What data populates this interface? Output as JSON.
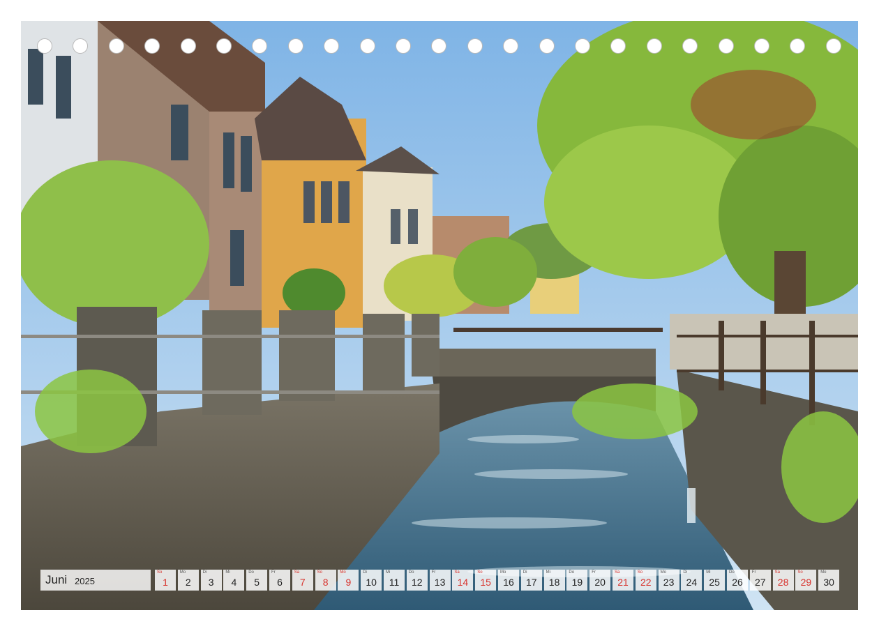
{
  "calendar": {
    "month": "Juni",
    "year": "2025",
    "days": [
      {
        "wd": "So",
        "d": "1",
        "we": true
      },
      {
        "wd": "Mo",
        "d": "2",
        "we": false
      },
      {
        "wd": "Di",
        "d": "3",
        "we": false
      },
      {
        "wd": "Mi",
        "d": "4",
        "we": false
      },
      {
        "wd": "Do",
        "d": "5",
        "we": false
      },
      {
        "wd": "Fr",
        "d": "6",
        "we": false
      },
      {
        "wd": "Sa",
        "d": "7",
        "we": true
      },
      {
        "wd": "So",
        "d": "8",
        "we": true
      },
      {
        "wd": "Mo",
        "d": "9",
        "we": true
      },
      {
        "wd": "Di",
        "d": "10",
        "we": false
      },
      {
        "wd": "Mi",
        "d": "11",
        "we": false
      },
      {
        "wd": "Do",
        "d": "12",
        "we": false
      },
      {
        "wd": "Fr",
        "d": "13",
        "we": false
      },
      {
        "wd": "Sa",
        "d": "14",
        "we": true
      },
      {
        "wd": "So",
        "d": "15",
        "we": true
      },
      {
        "wd": "Mo",
        "d": "16",
        "we": false
      },
      {
        "wd": "Di",
        "d": "17",
        "we": false
      },
      {
        "wd": "Mi",
        "d": "18",
        "we": false
      },
      {
        "wd": "Do",
        "d": "19",
        "we": false
      },
      {
        "wd": "Fr",
        "d": "20",
        "we": false
      },
      {
        "wd": "Sa",
        "d": "21",
        "we": true
      },
      {
        "wd": "So",
        "d": "22",
        "we": true
      },
      {
        "wd": "Mo",
        "d": "23",
        "we": false
      },
      {
        "wd": "Di",
        "d": "24",
        "we": false
      },
      {
        "wd": "Mi",
        "d": "25",
        "we": false
      },
      {
        "wd": "Do",
        "d": "26",
        "we": false
      },
      {
        "wd": "Fr",
        "d": "27",
        "we": false
      },
      {
        "wd": "Sa",
        "d": "28",
        "we": true
      },
      {
        "wd": "So",
        "d": "29",
        "we": true
      },
      {
        "wd": "Mo",
        "d": "30",
        "we": false
      }
    ]
  },
  "binding_holes": 23,
  "colors": {
    "weekend": "#d8322c",
    "sky": "#9cc8ee",
    "water": "#3f6f8e",
    "stone": "#6b6659",
    "foliage": "#7fb03a"
  }
}
